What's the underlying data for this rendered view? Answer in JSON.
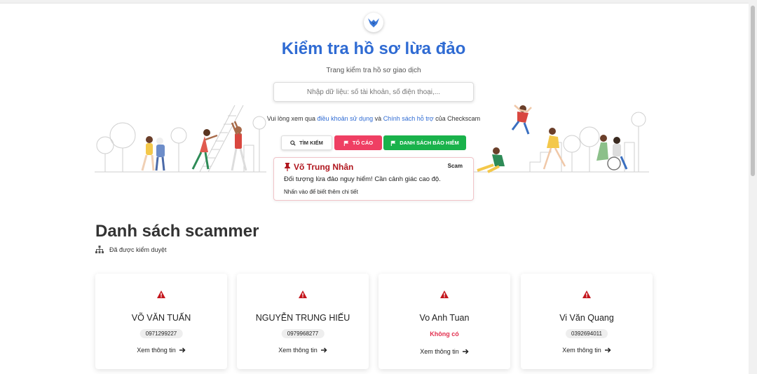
{
  "header": {
    "title": "Kiểm tra hồ sơ lừa đảo",
    "subtitle": "Trang kiểm tra hồ sơ giao dịch"
  },
  "search": {
    "placeholder": "Nhập dữ liệu: số tài khoản, số điện thoại,..."
  },
  "terms": {
    "prefix": "Vui lòng xem qua",
    "terms_link": "điều khoản sử dụng",
    "and": "và",
    "policy_link": "Chính sách hỗ trợ",
    "suffix": "của Checkscam"
  },
  "actions": {
    "search_label": "TÌM KIẾM",
    "report_label": "TỐ CÁO",
    "insurance_label": "DANH SÁCH BẢO HIỂM"
  },
  "alert": {
    "name": "Võ Trung Nhân",
    "tag": "Scam",
    "description": "Đối tượng lừa đảo nguy hiểm! Cần cảnh giác cao độ.",
    "more": "Nhấn vào để biết thêm chi tiết"
  },
  "scammers": {
    "title": "Danh sách scammer",
    "subtitle": "Đã được kiểm duyệt",
    "cards": [
      {
        "name": "VÕ VĂN TUẤN",
        "phone": "0971299227",
        "more": "Xem thông tin"
      },
      {
        "name": "NGUYỄN TRUNG HIẾU",
        "phone": "0979968277",
        "more": "Xem thông tin"
      },
      {
        "name": "Vo Anh Tuan",
        "phone": "Không có",
        "more": "Xem thông tin"
      },
      {
        "name": "Vi Văn Quang",
        "phone": "0392694011",
        "more": "Xem thông tin"
      }
    ]
  },
  "colors": {
    "accent_blue": "#2f6bd3",
    "report_red": "#ef3f63",
    "insurance_green": "#19b24b",
    "warning_red": "#c4151c"
  }
}
